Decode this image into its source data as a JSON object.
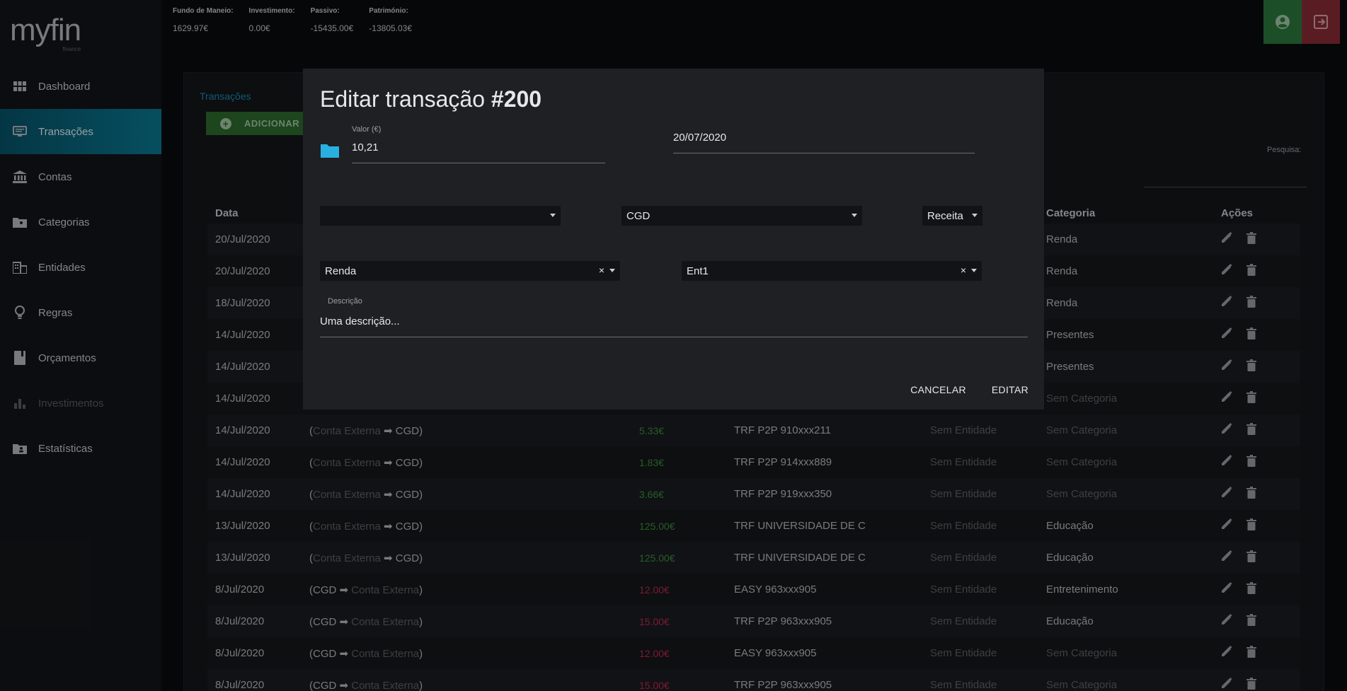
{
  "app": {
    "logo": "myfin",
    "logo_sub": "finance"
  },
  "sidebar": {
    "items": [
      {
        "label": "Dashboard",
        "icon": "grid-icon"
      },
      {
        "label": "Transações",
        "icon": "monitor-icon"
      },
      {
        "label": "Contas",
        "icon": "bank-icon"
      },
      {
        "label": "Categorias",
        "icon": "folder-icon"
      },
      {
        "label": "Entidades",
        "icon": "building-icon"
      },
      {
        "label": "Regras",
        "icon": "lightbulb-icon"
      },
      {
        "label": "Orçamentos",
        "icon": "book-icon"
      },
      {
        "label": "Investimentos",
        "icon": "bar-chart-icon"
      },
      {
        "label": "Estatísticas",
        "icon": "folder-user-icon"
      }
    ]
  },
  "header": {
    "stats": [
      {
        "label": "Fundo de Maneio:",
        "value": "1629.97€"
      },
      {
        "label": "Investimento:",
        "value": "0.00€"
      },
      {
        "label": "Passivo:",
        "value": "-15435.00€"
      },
      {
        "label": "Património:",
        "value": "-13805.03€"
      }
    ]
  },
  "page": {
    "breadcrumb": "Transações",
    "add_label": "ADICIONAR",
    "search_label": "Pesquisa:"
  },
  "table": {
    "headers": {
      "date": "Data",
      "category": "Categoria",
      "actions": "Ações"
    },
    "rows": [
      {
        "date": "20/Jul/2020",
        "category": "Renda"
      },
      {
        "date": "20/Jul/2020",
        "category": "Renda"
      },
      {
        "date": "18/Jul/2020",
        "category": "Renda"
      },
      {
        "date": "14/Jul/2020",
        "category": "Presentes"
      },
      {
        "date": "14/Jul/2020",
        "category": "Presentes"
      },
      {
        "date": "14/Jul/2020",
        "category": "Sem Categoria"
      },
      {
        "date": "14/Jul/2020",
        "from": "Conta Externa",
        "to": "CGD",
        "value": "5.33€",
        "description": "TRF P2P 910xxx211",
        "entity": "Sem Entidade",
        "category": "Sem Categoria"
      },
      {
        "date": "14/Jul/2020",
        "from": "Conta Externa",
        "to": "CGD",
        "value": "1.83€",
        "description": "TRF P2P 914xxx889",
        "entity": "Sem Entidade",
        "category": "Sem Categoria"
      },
      {
        "date": "14/Jul/2020",
        "from": "Conta Externa",
        "to": "CGD",
        "value": "3.66€",
        "description": "TRF P2P 919xxx350",
        "entity": "Sem Entidade",
        "category": "Sem Categoria"
      },
      {
        "date": "13/Jul/2020",
        "from": "Conta Externa",
        "to": "CGD",
        "value": "125.00€",
        "description": "TRF UNIVERSIDADE DE C",
        "entity": "Sem Entidade",
        "category": "Educação"
      },
      {
        "date": "13/Jul/2020",
        "from": "Conta Externa",
        "to": "CGD",
        "value": "125.00€",
        "description": "TRF UNIVERSIDADE DE C",
        "entity": "Sem Entidade",
        "category": "Educação"
      },
      {
        "date": "8/Jul/2020",
        "from": "CGD",
        "to": "Conta Externa",
        "value": "12.00€",
        "description": "EASY 963xxx905",
        "entity": "Sem Entidade",
        "category": "Entretenimento"
      },
      {
        "date": "8/Jul/2020",
        "from": "CGD",
        "to": "Conta Externa",
        "value": "15.00€",
        "description": "TRF P2P 963xxx905",
        "entity": "Sem Entidade",
        "category": "Educação"
      },
      {
        "date": "8/Jul/2020",
        "from": "CGD",
        "to": "Conta Externa",
        "value": "12.00€",
        "description": "EASY 963xxx905",
        "entity": "Sem Entidade",
        "category": "Sem Categoria"
      },
      {
        "date": "8/Jul/2020",
        "from": "CGD",
        "to": "Conta Externa",
        "value": "15.00€",
        "description": "TRF P2P 963xxx905",
        "entity": "Sem Entidade",
        "category": "Sem Categoria"
      }
    ]
  },
  "modal": {
    "title_prefix": "Editar transação ",
    "title_id": "#200",
    "amount_label": "Valor (€)",
    "amount_value": "10,21",
    "date_value": "20/07/2020",
    "account_from": "",
    "account_to": "CGD",
    "type": "Receita",
    "category": "Renda",
    "entity": "Ent1",
    "description_label": "Descrição",
    "description_value": "Uma descrição...",
    "cancel_label": "CANCELAR",
    "confirm_label": "EDITAR"
  },
  "colors": {
    "accent": "#0a7a93",
    "positive": "#3d8f3d",
    "negative": "#c0284f",
    "link": "#1a8bb4"
  }
}
